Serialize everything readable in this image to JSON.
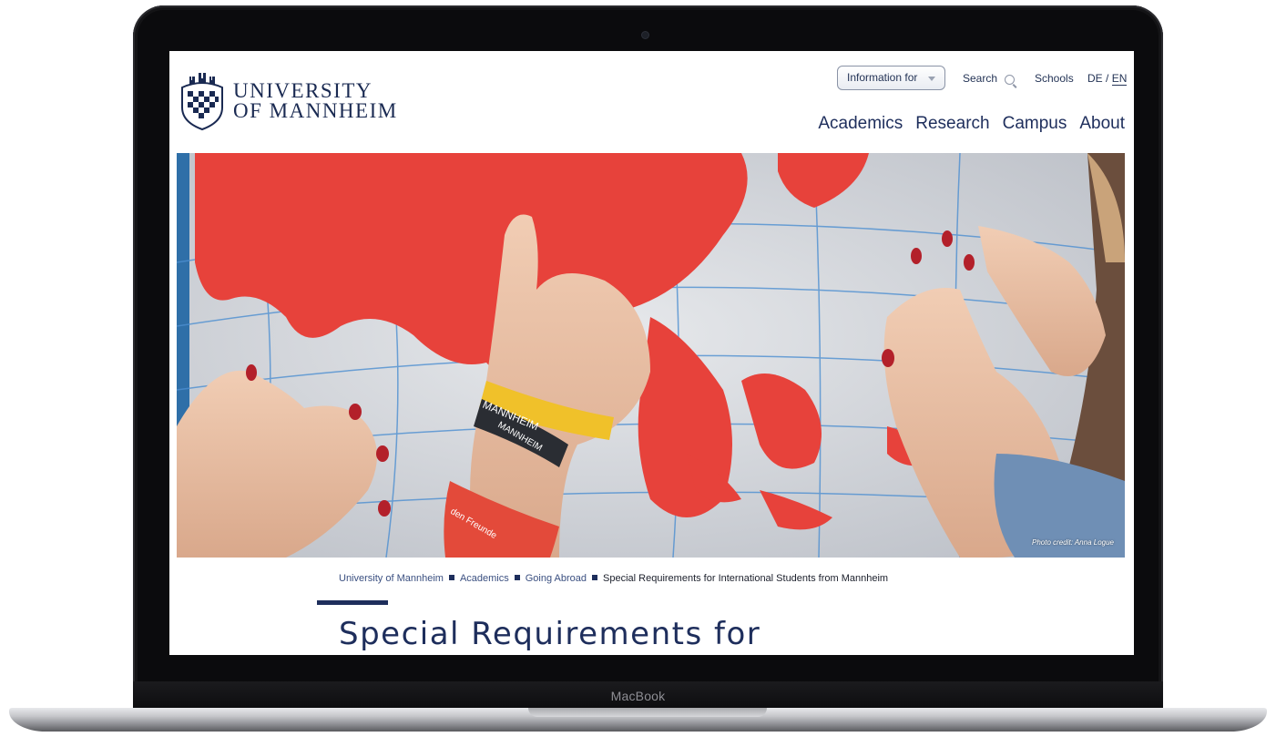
{
  "device": {
    "brand_label": "MacBook"
  },
  "header": {
    "logo_text_line1": "UNIVERSITY",
    "logo_text_line2": "OF MANNHEIM",
    "information_for_label": "Information for",
    "search_label": "Search",
    "schools_label": "Schools",
    "lang_de": "DE",
    "lang_sep": " / ",
    "lang_en": "EN",
    "nav": [
      "Academics",
      "Research",
      "Campus",
      "About"
    ]
  },
  "hero": {
    "photo_credit": "Photo credit: Anna Logue",
    "wristband_1_text": "MANNHEIM",
    "wristband_2_text": "MANNHEIM",
    "wristband_3_text": "den Freunde"
  },
  "breadcrumb": [
    "University of Mannheim",
    "Academics",
    "Going Abroad",
    "Special Requirements for International Students from Mannheim"
  ],
  "page": {
    "title": "Special Requirements for"
  },
  "colors": {
    "brand_navy": "#1e2e5c",
    "globe_red": "#e7423b",
    "globe_ocean": "#cfd3d8"
  }
}
